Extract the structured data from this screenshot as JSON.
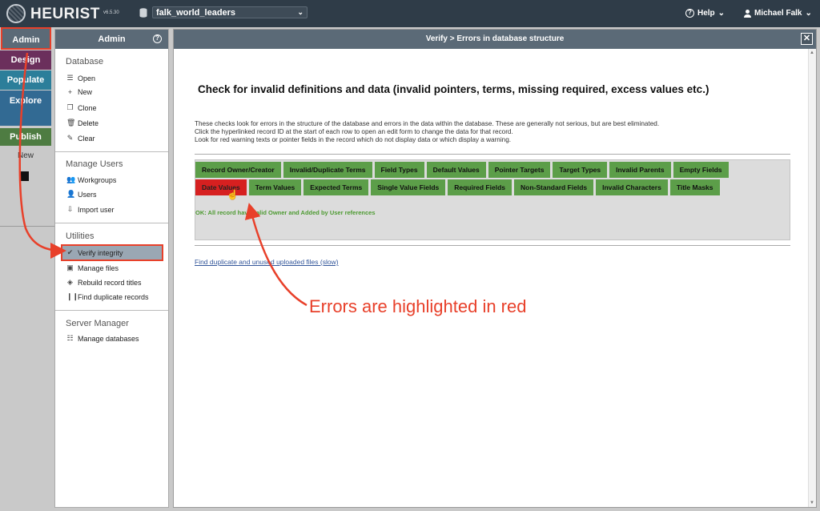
{
  "topbar": {
    "logo": "HEURIST",
    "version": "v6.5.30",
    "database": "falk_world_leaders",
    "help": "Help",
    "user": "Michael Falk"
  },
  "leftmenu": {
    "admin": "Admin",
    "design": "Design",
    "populate": "Populate",
    "explore": "Explore",
    "publish": "Publish",
    "new": "New"
  },
  "admin_panel": {
    "title": "Admin",
    "sections": {
      "database": "Database",
      "manage_users": "Manage Users",
      "utilities": "Utilities",
      "server_manager": "Server Manager"
    },
    "database_items": [
      "Open",
      "New",
      "Clone",
      "Delete",
      "Clear"
    ],
    "user_items": [
      "Workgroups",
      "Users",
      "Import user"
    ],
    "utility_items": [
      "Verify integrity",
      "Manage files",
      "Rebuild record titles",
      "Find duplicate records"
    ],
    "server_items": [
      "Manage databases"
    ]
  },
  "dialog": {
    "title": "Verify > Errors in database structure",
    "close": "✕",
    "heading": "Check for invalid definitions and data (invalid pointers, terms, missing required, excess values etc.)",
    "desc1": "These checks look for errors in the structure of the database and errors in the data within the database. These are generally not serious, but are best eliminated.",
    "desc2": "Click the hyperlinked record ID at the start of each row to open an edit form to change the data for that record.",
    "desc3": "Look for red warning texts or pointer fields in the record which do not display data or which display a warning.",
    "tabs_row1": [
      "Record Owner/Creator",
      "Invalid/Duplicate Terms",
      "Field Types",
      "Default Values",
      "Pointer Targets",
      "Target Types",
      "Invalid Parents",
      "Empty Fields"
    ],
    "tabs_row2": [
      "Date Values",
      "Term Values",
      "Expected Terms",
      "Single Value Fields",
      "Required Fields",
      "Non-Standard Fields",
      "Invalid Characters",
      "Title Masks"
    ],
    "ok_message": "OK: All record have valid Owner and Added by User references",
    "dup_link": "Find duplicate and unused uploaded files (slow)"
  },
  "annotation": "Errors are highlighted in red",
  "colors": {
    "topbar": "#2f3c48",
    "header": "#5b6a77",
    "tab_ok": "#5c9e49",
    "tab_error": "#d62020",
    "annotation": "#e8402a"
  }
}
